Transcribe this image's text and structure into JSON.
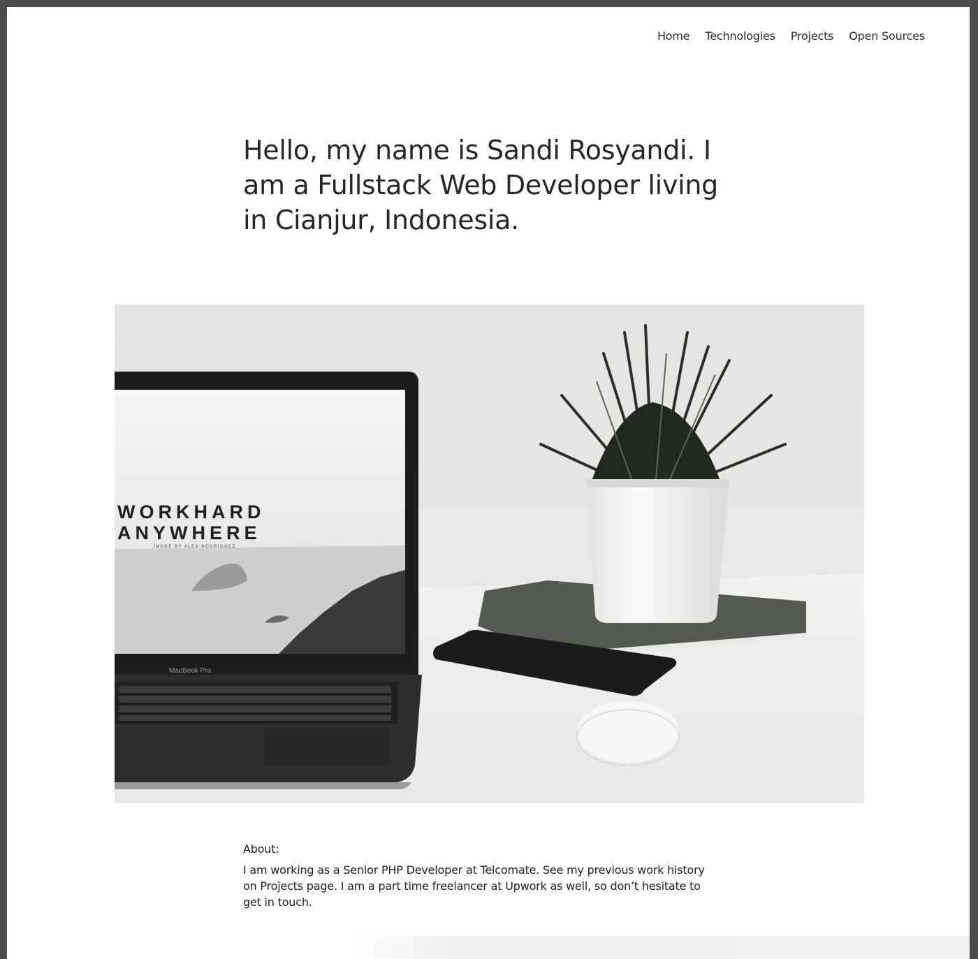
{
  "nav": {
    "items": [
      {
        "label": "Home"
      },
      {
        "label": "Technologies"
      },
      {
        "label": "Projects"
      },
      {
        "label": "Open Sources"
      }
    ]
  },
  "intro": {
    "text": "Hello, my name is Sandi Rosyandi. I am a Fullstack Web Developer living in Cianjur, Indonesia."
  },
  "hero": {
    "screen_line1": "WORKHARD",
    "screen_line2": "ANYWHERE",
    "screen_credit": "IMAGE BY ALEX RODRIGUEZ",
    "laptop_label": "MacBook Pro"
  },
  "about": {
    "heading": "About:",
    "text": "I am working as a Senior PHP Developer at Telcomate. See my previous work history on Projects page. I am a part time freelancer at Upwork as well, so don’t hesitate to get in touch."
  }
}
